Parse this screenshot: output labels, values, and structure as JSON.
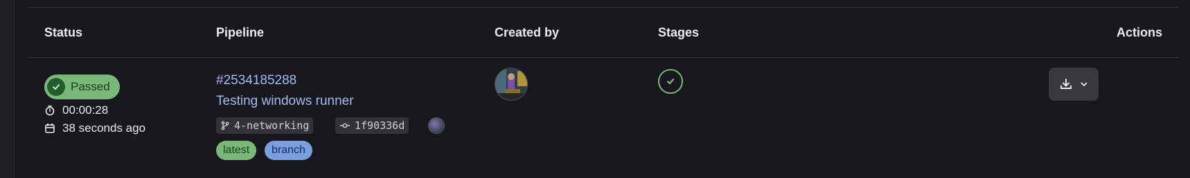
{
  "table": {
    "headers": {
      "status": "Status",
      "pipeline": "Pipeline",
      "created_by": "Created by",
      "stages": "Stages",
      "actions": "Actions"
    }
  },
  "row": {
    "status": {
      "label": "Passed",
      "duration": "00:00:28",
      "finished": "38 seconds ago",
      "color": "#7ab87a"
    },
    "pipeline": {
      "id": "#2534185288",
      "title": "Testing windows runner",
      "branch": "4-networking",
      "commit": "1f90336d",
      "tags": [
        "latest",
        "branch"
      ]
    },
    "created_by": {
      "avatar_icon": "user-avatar"
    },
    "stages": {
      "icon": "status-success-icon"
    },
    "actions": {
      "icon": "download-icon",
      "dropdown_icon": "chevron-down-icon"
    }
  }
}
